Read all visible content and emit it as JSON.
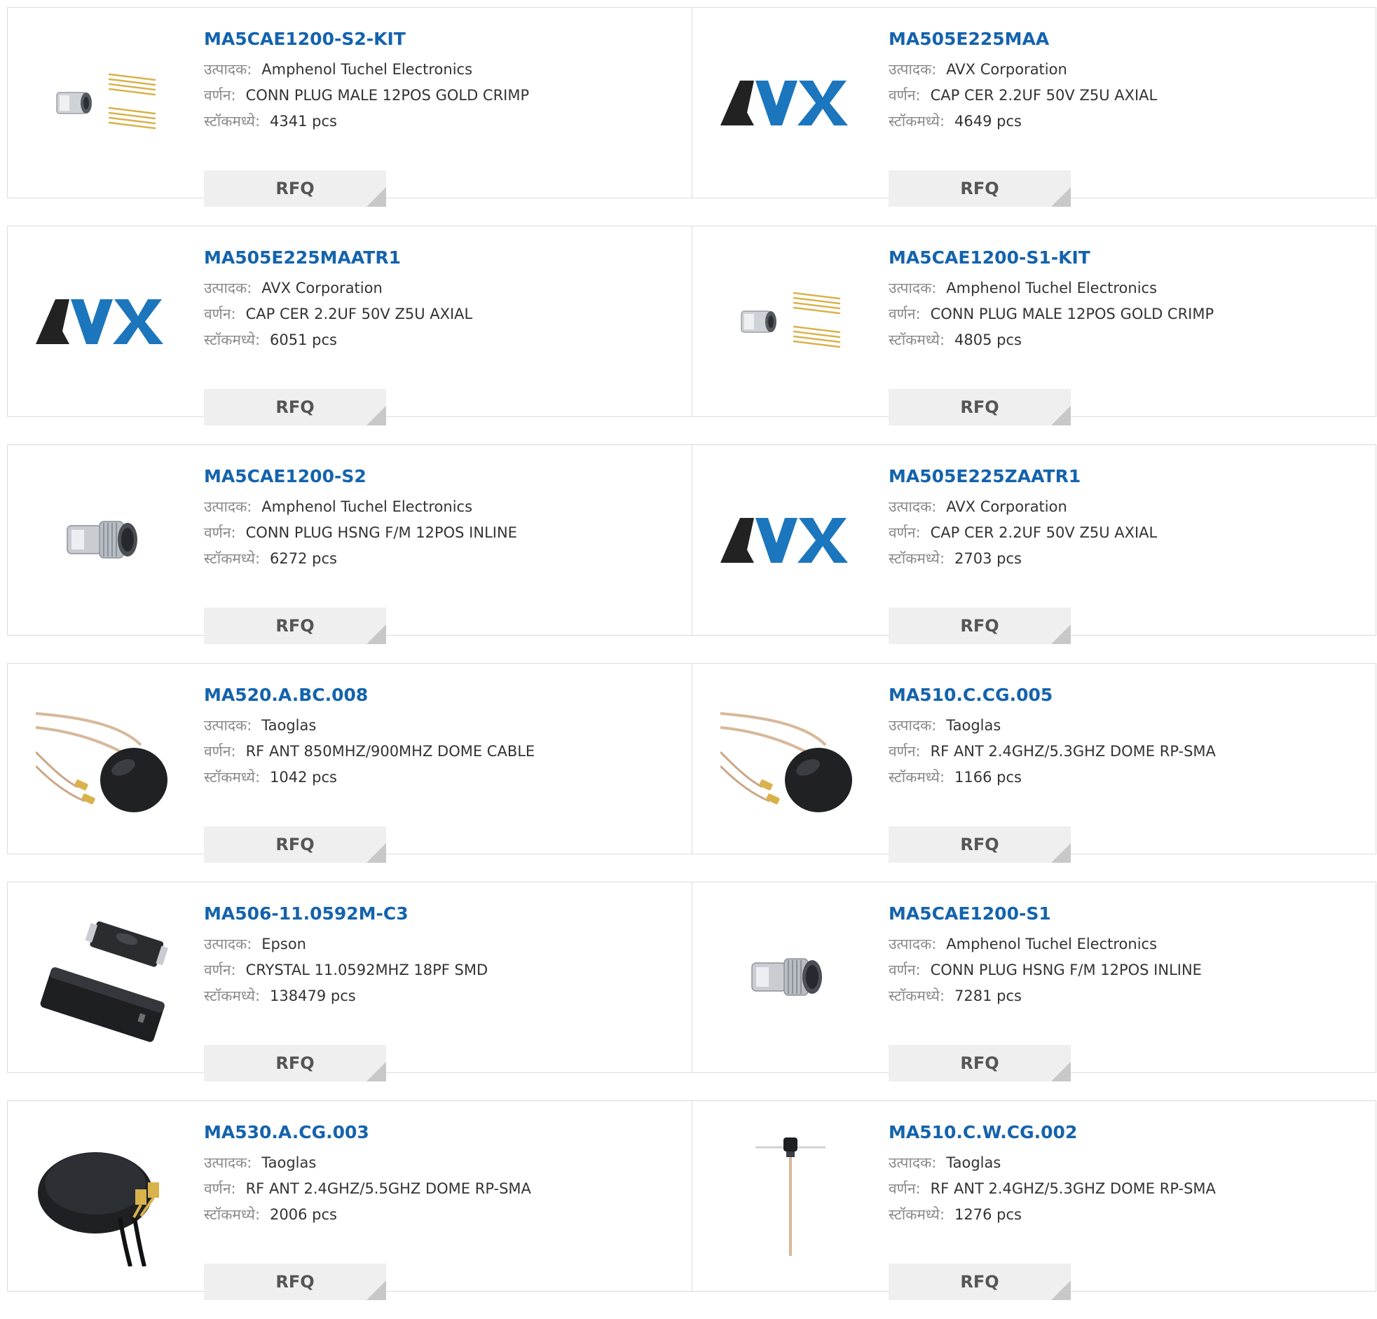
{
  "labels": {
    "manufacturer": "उत्पादक:",
    "description": "वर्णन:",
    "stock": "स्टॉकमध्ये:",
    "rfq": "RFQ"
  },
  "colors": {
    "part_link": "#1463ad",
    "rfq_bg": "#efefef",
    "border": "#dcdcdc",
    "avx_blue": "#1c76bd"
  },
  "products": [
    {
      "part": "MA5CAE1200-S2-KIT",
      "manufacturer": "Amphenol Tuchel Electronics",
      "description": "CONN PLUG MALE 12POS GOLD CRIMP",
      "stock": "4341 pcs",
      "image": "connector-kit-image"
    },
    {
      "part": "MA505E225MAA",
      "manufacturer": "AVX Corporation",
      "description": "CAP CER 2.2UF 50V Z5U AXIAL",
      "stock": "4649 pcs",
      "image": "avx-logo-image"
    },
    {
      "part": "MA505E225MAATR1",
      "manufacturer": "AVX Corporation",
      "description": "CAP CER 2.2UF 50V Z5U AXIAL",
      "stock": "6051 pcs",
      "image": "avx-logo-image"
    },
    {
      "part": "MA5CAE1200-S1-KIT",
      "manufacturer": "Amphenol Tuchel Electronics",
      "description": "CONN PLUG MALE 12POS GOLD CRIMP",
      "stock": "4805 pcs",
      "image": "connector-kit-image"
    },
    {
      "part": "MA5CAE1200-S2",
      "manufacturer": "Amphenol Tuchel Electronics",
      "description": "CONN PLUG HSNG F/M 12POS INLINE",
      "stock": "6272 pcs",
      "image": "connector-housing-image"
    },
    {
      "part": "MA505E225ZAATR1",
      "manufacturer": "AVX Corporation",
      "description": "CAP CER 2.2UF 50V Z5U AXIAL",
      "stock": "2703 pcs",
      "image": "avx-logo-image"
    },
    {
      "part": "MA520.A.BC.008",
      "manufacturer": "Taoglas",
      "description": "RF ANT 850MHZ/900MHZ DOME CABLE",
      "stock": "1042 pcs",
      "image": "dome-antenna-cable-image"
    },
    {
      "part": "MA510.C.CG.005",
      "manufacturer": "Taoglas",
      "description": "RF ANT 2.4GHZ/5.3GHZ DOME RP-SMA",
      "stock": "1166 pcs",
      "image": "dome-antenna-cable-image"
    },
    {
      "part": "MA506-11.0592M-C3",
      "manufacturer": "Epson",
      "description": "CRYSTAL 11.0592MHZ 18PF SMD",
      "stock": "138479 pcs",
      "image": "crystal-smd-image"
    },
    {
      "part": "MA5CAE1200-S1",
      "manufacturer": "Amphenol Tuchel Electronics",
      "description": "CONN PLUG HSNG F/M 12POS INLINE",
      "stock": "7281 pcs",
      "image": "connector-housing-image"
    },
    {
      "part": "MA530.A.CG.003",
      "manufacturer": "Taoglas",
      "description": "RF ANT 2.4GHZ/5.5GHZ DOME RP-SMA",
      "stock": "2006 pcs",
      "image": "puck-antenna-image"
    },
    {
      "part": "MA510.C.W.CG.002",
      "manufacturer": "Taoglas",
      "description": "RF ANT 2.4GHZ/5.3GHZ DOME RP-SMA",
      "stock": "1276 pcs",
      "image": "whip-antenna-image"
    }
  ]
}
